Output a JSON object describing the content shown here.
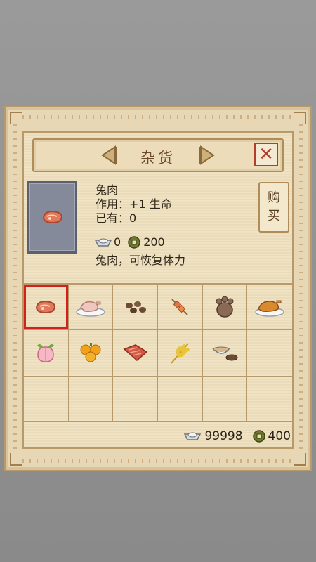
{
  "shop": {
    "title": "杂货",
    "close_label": "✕",
    "buy_label_1": "购",
    "buy_label_2": "买"
  },
  "item": {
    "name": "兔肉",
    "effect_label": "作用：",
    "effect_value": "+1 生命",
    "owned_label": "已有：",
    "owned_value": "0",
    "price_silver": "0",
    "price_coin": "200",
    "description": "兔肉，可恢复体力"
  },
  "grid": {
    "items": [
      {
        "icon": "rabbit-meat-icon"
      },
      {
        "icon": "roast-chicken-plate-icon"
      },
      {
        "icon": "nuts-icon"
      },
      {
        "icon": "skewer-icon"
      },
      {
        "icon": "bear-paw-icon"
      },
      {
        "icon": "roast-duck-plate-icon"
      },
      {
        "icon": "peach-icon"
      },
      {
        "icon": "oranges-icon"
      },
      {
        "icon": "cured-meat-icon"
      },
      {
        "icon": "wheat-icon"
      },
      {
        "icon": "rice-bowl-icon"
      }
    ],
    "selected_index": 0
  },
  "wallet": {
    "silver": "99998",
    "coins": "400"
  },
  "colors": {
    "selected_border": "#d3201d",
    "close_red": "#b33c2a"
  }
}
